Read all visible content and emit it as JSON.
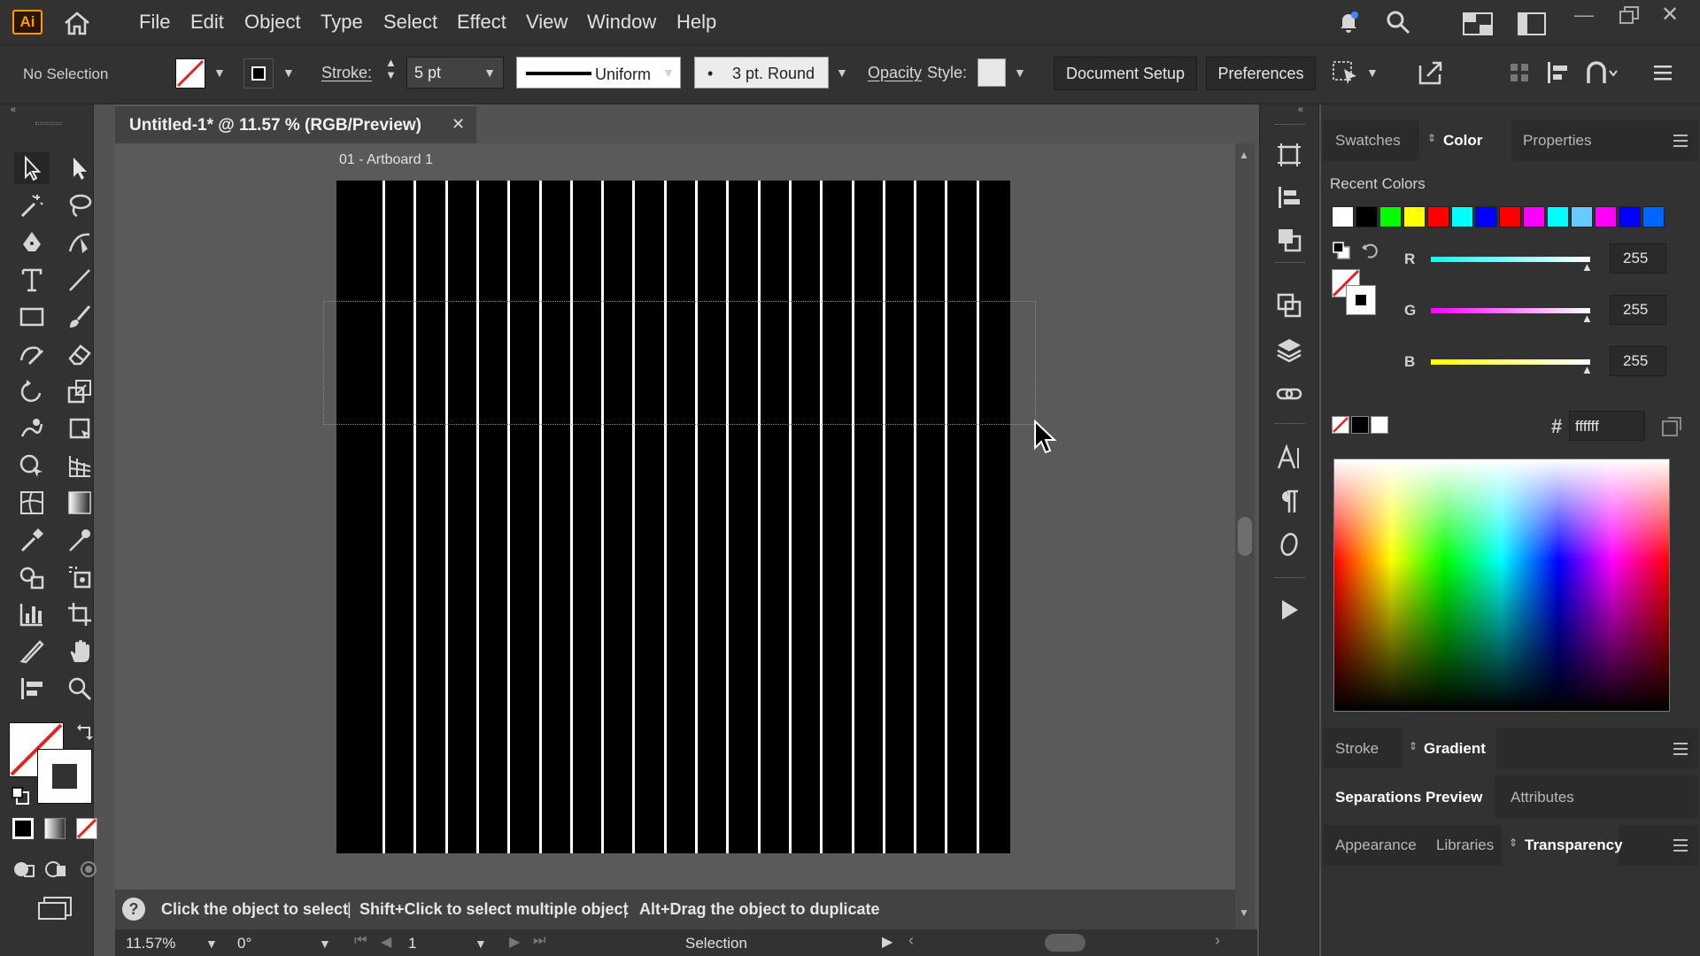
{
  "app": {
    "logo_text": "Ai"
  },
  "menu": {
    "items": [
      "File",
      "Edit",
      "Object",
      "Type",
      "Select",
      "Effect",
      "View",
      "Window",
      "Help"
    ]
  },
  "control": {
    "selection_label": "No Selection",
    "stroke_label": "Stroke:",
    "stroke_value": "5 pt",
    "profile_label": "Uniform",
    "brush_label": "3 pt. Round",
    "opacity_label": "Opacity",
    "style_label": "Style:",
    "document_setup": "Document Setup",
    "preferences": "Preferences"
  },
  "document": {
    "tab_title": "Untitled-1* @ 11.57 % (RGB/Preview)",
    "close_glyph": "✕",
    "artboard_label": "01 - Artboard 1",
    "stripe_count": 20,
    "stripe_color": "#ffffff",
    "artboard_color": "#000000"
  },
  "panels": {
    "top_tabs": [
      "Swatches",
      "Color",
      "Properties"
    ],
    "active_top_tab": "Color",
    "recent_colors_label": "Recent Colors",
    "recent_colors": [
      "#ffffff",
      "#000000",
      "#00ff00",
      "#ffff00",
      "#ff0000",
      "#00ffff",
      "#0000ff",
      "#ff0000",
      "#ff00ff",
      "#00ffff",
      "#66ccff",
      "#ff00ff",
      "#0000ff",
      "#0066ff"
    ],
    "r_label": "R",
    "g_label": "G",
    "b_label": "B",
    "r_value": "255",
    "g_value": "255",
    "b_value": "255",
    "hash": "#",
    "hex_value": "ffffff",
    "stroke_tab": "Stroke",
    "gradient_tab": "Gradient",
    "separations_tab": "Separations Preview",
    "attributes_tab": "Attributes",
    "appearance_tab": "Appearance",
    "libraries_tab": "Libraries",
    "transparency_tab": "Transparency"
  },
  "status": {
    "hint_1": "Click the object to select",
    "sep": "|",
    "hint_2": "Shift+Click to select multiple object",
    "hint_3": "Alt+Drag the object to duplicate",
    "zoom": "11.57%",
    "rotation": "0°",
    "artboard_number": "1",
    "tool_name": "Selection"
  },
  "colors": {
    "accent_red": "#e52222",
    "logo_orange": "#ff9a00"
  }
}
